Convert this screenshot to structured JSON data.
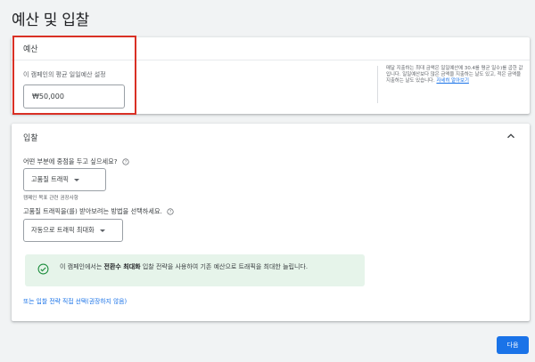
{
  "page": {
    "title": "예산 및 입찰"
  },
  "budget": {
    "header": "예산",
    "label": "이 캠페인의 평균 일일예산 설정",
    "value": "₩50,000",
    "help_text": "매달 지출하는 최대 금액은 일일예산에 30.4를 평균 일수)를 곱한 값입니다. 일일예산보다 많은 금액을 지출하는 날도 있고, 적은 금액을 지출하는 날도 있습니다.",
    "help_link": "자세히 알아보기"
  },
  "bidding": {
    "header": "입찰",
    "question1": "어떤 부분에 중점을 두고 싶으세요?",
    "dropdown1_value": "고품질 트래픽",
    "hint": "캠페인 목표 관련 권장사항",
    "question2": "고품질 트래픽을(를) 받아보려는 방법을 선택하세요.",
    "dropdown2_value": "자동으로 트래픽 최대화",
    "banner_text_before": "이 캠페인에서는 ",
    "banner_text_bold": "전환수 최대화",
    "banner_text_after": " 입찰 전략을 사용하여 기존 예산으로 트래픽을 최대한 늘립니다.",
    "manual_link": "또는 입찰 전략 직접 선택(권장하지 않음)"
  },
  "footer": {
    "next_label": "다음"
  },
  "colors": {
    "accent": "#1a73e8",
    "highlight": "#d93025",
    "banner_bg": "#e6f4ea",
    "success": "#1e8e3e"
  },
  "icons": {
    "collapse": "chevron-up-icon",
    "help": "help-circle-icon",
    "check": "check-circle-icon",
    "dropdown": "caret-down-icon"
  }
}
